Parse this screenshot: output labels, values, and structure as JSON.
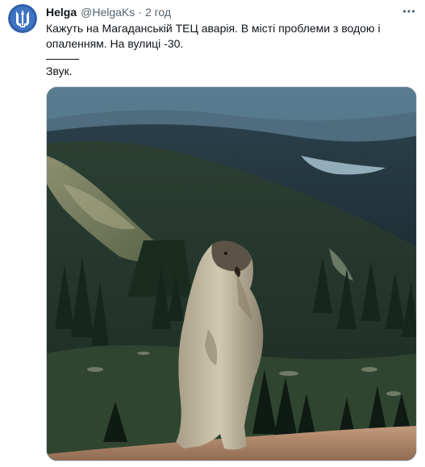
{
  "author": {
    "display_name": "Helga",
    "handle": "@HelgaKs",
    "separator": "·",
    "time": "2 год"
  },
  "tweet": {
    "text": "Кажуть на Магаданській ТЕЦ аварія. В місті проблеми з водою і опаленням. На вулиці -30.",
    "sound_note": "Звук."
  },
  "icons": {
    "more": "more-horizontal-icon",
    "avatar": "trident-logo"
  },
  "colors": {
    "text_primary": "#0f1419",
    "text_secondary": "#536471",
    "avatar_bg": "#2f5fa8",
    "media_border": "#cfd9de"
  }
}
